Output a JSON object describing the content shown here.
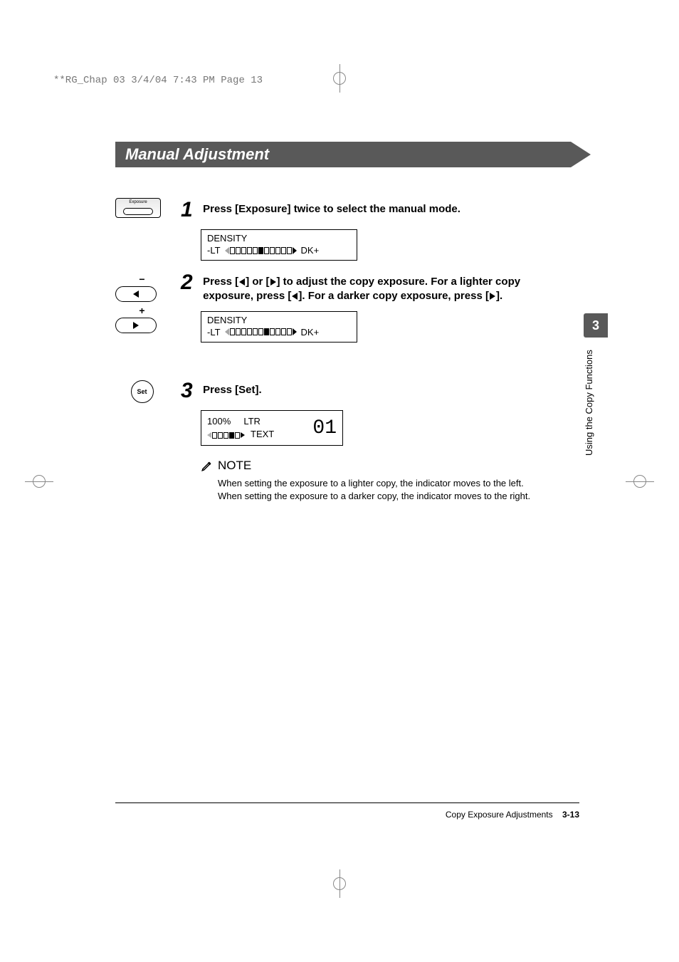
{
  "print_header": "**RG_Chap 03  3/4/04  7:43 PM  Page 13",
  "section_title": "Manual Adjustment",
  "tab": {
    "number": "3",
    "label": "Using the Copy Functions"
  },
  "steps": {
    "s1": {
      "num": "1",
      "key_label": "Exposure",
      "text": "Press [Exposure] twice to select the manual mode.",
      "lcd_title": "DENSITY",
      "lcd_left": "-LT",
      "lcd_right": "DK+",
      "filled_index": 5,
      "total_segments": 11
    },
    "s2": {
      "num": "2",
      "minus": "−",
      "plus": "+",
      "text_a": "Press [",
      "text_b": "] or [",
      "text_c": "] to adjust the copy exposure. For a lighter copy exposure, press [",
      "text_d": "]. For a darker copy exposure, press [",
      "text_e": "].",
      "lcd_title": "DENSITY",
      "lcd_left": "-LT",
      "lcd_right": "DK+",
      "filled_index": 6,
      "total_segments": 11
    },
    "s3": {
      "num": "3",
      "key_label": "Set",
      "text": "Press [Set].",
      "lcd_zoom": "100%",
      "lcd_paper": "LTR",
      "lcd_mode": "TEXT",
      "lcd_count": "01",
      "mini_filled_index": 3,
      "mini_total": 5
    }
  },
  "note": {
    "heading": "NOTE",
    "body": "When setting the exposure to a lighter copy, the indicator moves to the left. When setting the exposure to a darker copy, the indicator moves to the right."
  },
  "footer": {
    "section": "Copy Exposure Adjustments",
    "page": "3-13"
  }
}
